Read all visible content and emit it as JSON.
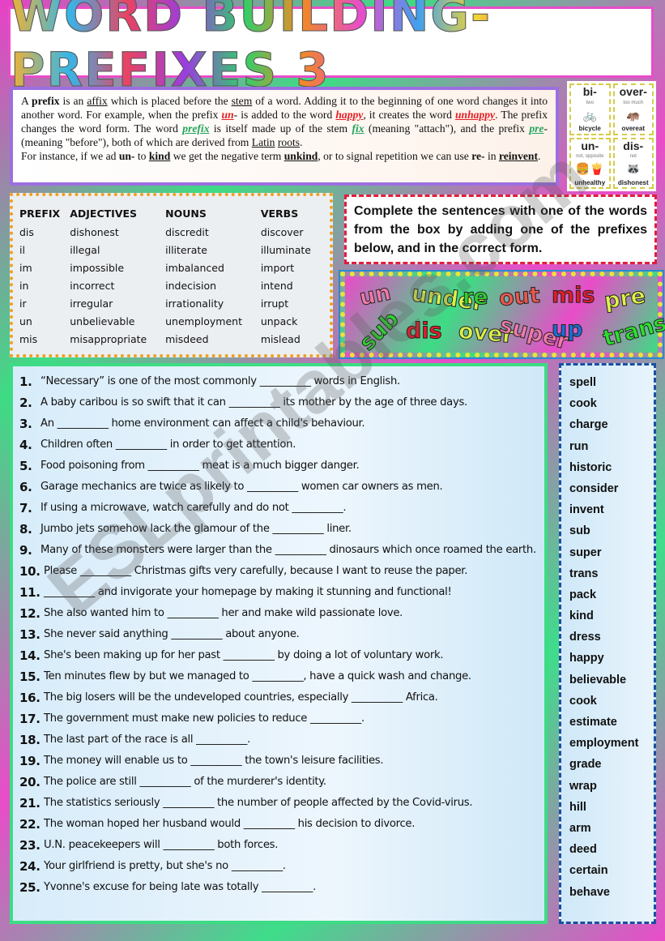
{
  "title": "WORD BUILDING-PREFIXES 3",
  "intro": {
    "p1": "A ",
    "prefix": "prefix",
    "p2": " is an ",
    "affix": "affix",
    "p3": " which is placed before the ",
    "stem": "stem",
    "p4": " of a word. Adding it to the beginning of one word changes it into another word. For example, when the prefix ",
    "un": "un",
    "p5": "- is added to the word ",
    "happy": "happy",
    "p6": ", it creates the word ",
    "unhappy": "unhappy",
    "p7": ".  The  prefix changes the word form. The word ",
    "prefix2": "prefix",
    "p8": " is itself made up of the stem ",
    "fix": "fix",
    "p9": " (meaning \"attach\"), and the prefix ",
    "pre": "pre",
    "p10": "- (meaning \"before\"), both of which are derived from ",
    "latin": "Latin",
    "p11": " ",
    "roots": "roots",
    "p12": ".",
    "p13": "For instance, if we ad ",
    "un2": "un-",
    "p14": " to ",
    "kind": "kind",
    "p15": " we get the negative term ",
    "unkind": "unkind",
    "p16": ", or to signal repetition we can use ",
    "re": "re-",
    "p17": " in ",
    "reinvent": "reinvent",
    "p18": "."
  },
  "cards": [
    {
      "prefix": "bi-",
      "meaning": "two",
      "icon": "bicycle-icon",
      "pic": "🚲",
      "example": "bicycle"
    },
    {
      "prefix": "over-",
      "meaning": "too much",
      "icon": "hippo-icon",
      "pic": "🦛",
      "example": "overeat"
    },
    {
      "prefix": "un-",
      "meaning": "not, opposite",
      "icon": "burger-fries-icon",
      "pic": "🍔🍟",
      "example": "unhealthy"
    },
    {
      "prefix": "dis-",
      "meaning": "not",
      "icon": "raccoon-icon",
      "pic": "🦝",
      "example": "dishonest"
    }
  ],
  "table": {
    "headers": [
      "PREFIX",
      "ADJECTIVES",
      "NOUNS",
      "VERBS"
    ],
    "rows": [
      [
        "dis",
        "dishonest",
        "discredit",
        "discover"
      ],
      [
        "il",
        "illegal",
        "illiterate",
        "illuminate"
      ],
      [
        "im",
        "impossible",
        "imbalanced",
        "import"
      ],
      [
        "in",
        "incorrect",
        "indecision",
        "intend"
      ],
      [
        "ir",
        "irregular",
        "irrationality",
        "irrupt"
      ],
      [
        "un",
        "unbelievable",
        "unemployment",
        "unpack"
      ],
      [
        "mis",
        "misappropriate",
        "misdeed",
        "mislead"
      ]
    ]
  },
  "instruction": "Complete the sentences with one of the words from the box by adding one of the prefixes below, and in the correct form.",
  "prefixes": [
    {
      "t": "un",
      "c": "#f07aa8"
    },
    {
      "t": "under",
      "c": "#d8f04a"
    },
    {
      "t": "re",
      "c": "#2fd02f"
    },
    {
      "t": "out",
      "c": "#e8584f"
    },
    {
      "t": "mis",
      "c": "#e01e2a"
    },
    {
      "t": "pre",
      "c": "#e0f04a"
    },
    {
      "t": "sub",
      "c": "#2fd02f"
    },
    {
      "t": "dis",
      "c": "#e01e2a"
    },
    {
      "t": "over",
      "c": "#d8f04a"
    },
    {
      "t": "super",
      "c": "#f07aa8"
    },
    {
      "t": "up",
      "c": "#1a6fd0"
    },
    {
      "t": "trans",
      "c": "#2fe02f"
    }
  ],
  "sentences": [
    {
      "n": "1.",
      "t": "“Necessary” is one of the most commonly __________ words in English."
    },
    {
      "n": "2.",
      "t": "A baby caribou is so swift that it can __________ its mother by the age of three days."
    },
    {
      "n": "3.",
      "t": "An __________ home environment can affect a child's behaviour."
    },
    {
      "n": "4.",
      "t": "Children often __________ in order to get attention."
    },
    {
      "n": "5.",
      "t": "Food poisoning from __________ meat is a much bigger danger."
    },
    {
      "n": "6.",
      "t": "Garage mechanics are twice as likely to __________ women car owners as men."
    },
    {
      "n": "7.",
      "t": "If using a microwave, watch carefully and do not __________."
    },
    {
      "n": "8.",
      "t": "Jumbo jets somehow lack the glamour of the __________ liner."
    },
    {
      "n": "9.",
      "t": "Many of these monsters were larger than the __________ dinosaurs which once roamed the earth."
    },
    {
      "n": "10.",
      "t": "Please __________ Christmas gifts very carefully, because I want to reuse the paper."
    },
    {
      "n": "11.",
      "t": "__________ and invigorate your homepage by making it stunning and functional!"
    },
    {
      "n": "12.",
      "t": "She also wanted him to __________ her and make wild passionate love."
    },
    {
      "n": "13.",
      "t": "She never said anything __________ about anyone."
    },
    {
      "n": "14.",
      "t": "She's been making up for her past __________ by doing a lot of voluntary work."
    },
    {
      "n": "15.",
      "t": "Ten minutes flew by but we managed to __________, have a quick wash and change."
    },
    {
      "n": "16.",
      "t": "The big losers will be the undeveloped countries, especially __________ Africa."
    },
    {
      "n": "17.",
      "t": "The government must make new policies to reduce __________."
    },
    {
      "n": "18.",
      "t": "The last part of the race is all __________."
    },
    {
      "n": "19.",
      "t": "The money will enable us to __________ the town's leisure facilities."
    },
    {
      "n": "20.",
      "t": "The police are still __________ of the murderer's identity."
    },
    {
      "n": "21.",
      "t": "The statistics seriously __________ the number of people affected by the Covid-virus."
    },
    {
      "n": "22.",
      "t": "The woman hoped her husband would __________ his decision to divorce."
    },
    {
      "n": "23.",
      "t": "U.N. peacekeepers will __________ both forces."
    },
    {
      "n": "24.",
      "t": "Your girlfriend is pretty, but she's no __________."
    },
    {
      "n": "25.",
      "t": "Yvonne's excuse for being late was totally __________."
    }
  ],
  "words": [
    "spell",
    "cook",
    "charge",
    "run",
    "historic",
    "consider",
    "invent",
    "sub",
    "super",
    "trans",
    "pack",
    "kind",
    "dress",
    "happy",
    "believable",
    "cook",
    "estimate",
    "employment",
    "grade",
    "wrap",
    "hill",
    "arm",
    "deed",
    "certain",
    "behave"
  ],
  "watermark": "ESLprintables.com"
}
